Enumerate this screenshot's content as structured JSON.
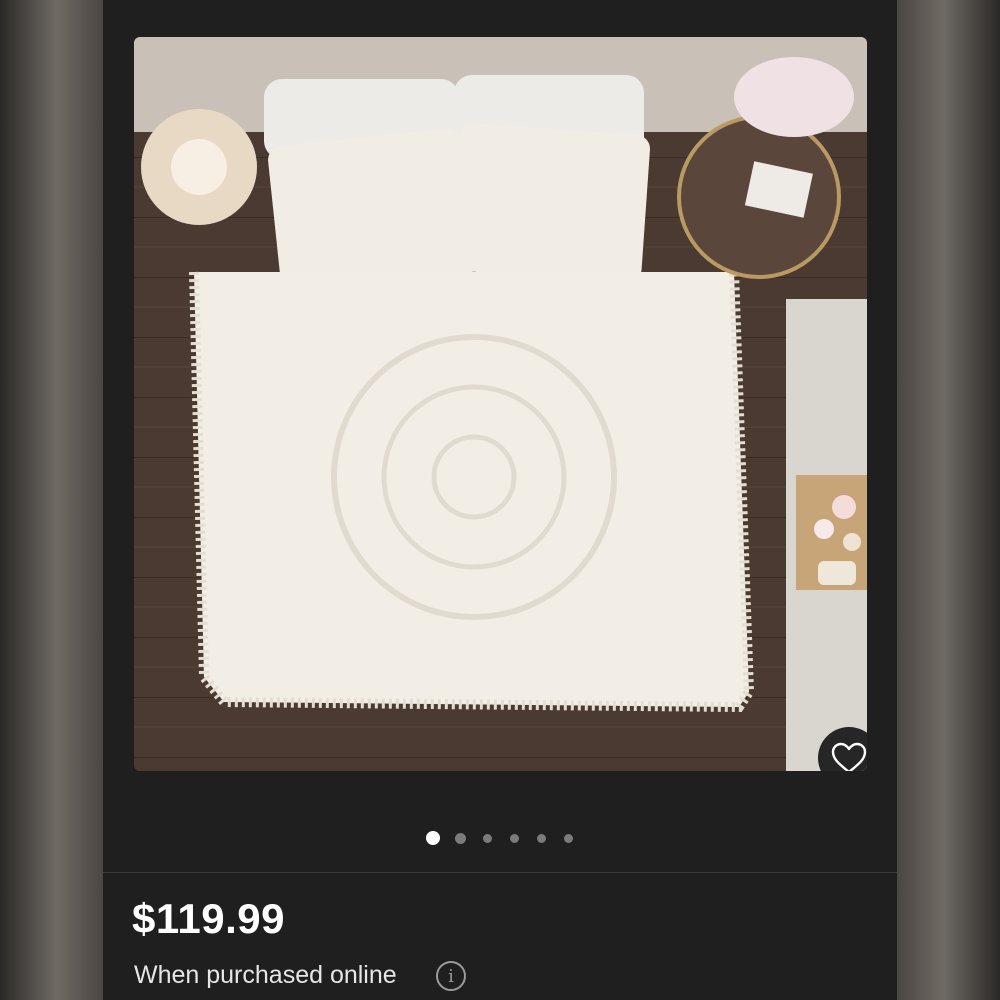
{
  "product": {
    "image_alt": "White medallion chenille comforter set with tassel fringe on a bed",
    "favorite_icon": "heart-outline-icon",
    "price": "$119.99",
    "price_note": "When purchased online",
    "info_icon": "info-icon",
    "info_glyph": "i"
  },
  "carousel": {
    "total": 6,
    "active_index": 0
  },
  "colors": {
    "background": "#1f1f1f",
    "price_text": "#ffffff",
    "dot_active": "#ffffff",
    "dot_inactive": "#7b7b7b"
  }
}
